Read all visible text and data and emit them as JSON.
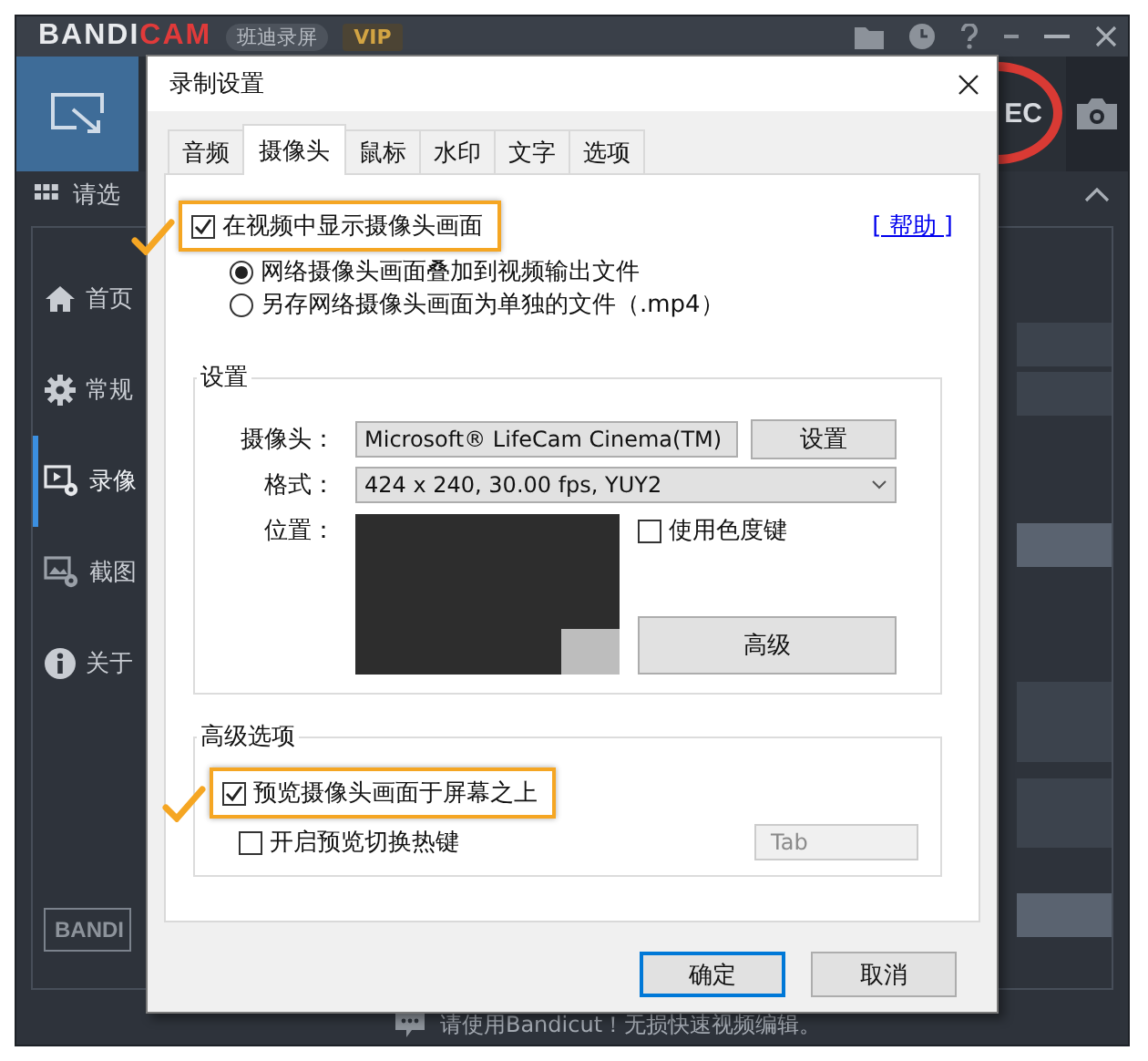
{
  "app": {
    "logo": {
      "main": "BANDI",
      "accent": "CAM"
    },
    "badges": [
      {
        "text": "班迪录屏",
        "kind": "product"
      },
      {
        "text": "VIP",
        "kind": "vip"
      }
    ],
    "rec_label": "EC",
    "section_title": "请选",
    "sidebar": [
      {
        "label": "首页",
        "selected": false
      },
      {
        "label": "常规",
        "selected": false
      },
      {
        "label": "录像",
        "selected": true
      },
      {
        "label": "截图",
        "selected": false
      },
      {
        "label": "关于",
        "selected": false
      }
    ],
    "footer_logo": "BANDI",
    "status_bar": "请使用Bandicut！无损快速视频编辑。"
  },
  "dialog": {
    "title": "录制设置",
    "tabs": [
      {
        "label": "音频",
        "selected": false
      },
      {
        "label": "摄像头",
        "selected": true
      },
      {
        "label": "鼠标",
        "selected": false
      },
      {
        "label": "水印",
        "selected": false
      },
      {
        "label": "文字",
        "selected": false
      },
      {
        "label": "选项",
        "selected": false
      }
    ],
    "show_webcam": {
      "label": "在视频中显示摄像头画面",
      "checked": true,
      "highlighted": true
    },
    "help_link": "[ 帮助 ]",
    "output_modes": [
      {
        "label": "网络摄像头画面叠加到视频输出文件",
        "selected": true
      },
      {
        "label": "另存网络摄像头画面为单独的文件（.mp4）",
        "selected": false
      }
    ],
    "settings": {
      "title": "设置",
      "camera": {
        "label": "摄像头：",
        "value": "Microsoft® LifeCam Cinema(TM)",
        "button": "设置"
      },
      "format": {
        "label": "格式：",
        "value": "424 x 240, 30.00 fps, YUY2"
      },
      "position": {
        "label": "位置：",
        "marker_right": true,
        "marker_bottom": true
      },
      "chroma_key": {
        "label": "使用色度键",
        "checked": false
      },
      "advanced_button": "高级"
    },
    "advanced": {
      "title": "高级选项",
      "preview_on_top": {
        "label": "预览摄像头画面于屏幕之上",
        "checked": true,
        "highlighted": true
      },
      "preview_hotkey": {
        "label": "开启预览切换热键",
        "checked": false,
        "key": "Tab",
        "disabled": true
      }
    },
    "buttons": [
      {
        "label": "确定",
        "default": true
      },
      {
        "label": "取消",
        "default": false
      }
    ]
  }
}
